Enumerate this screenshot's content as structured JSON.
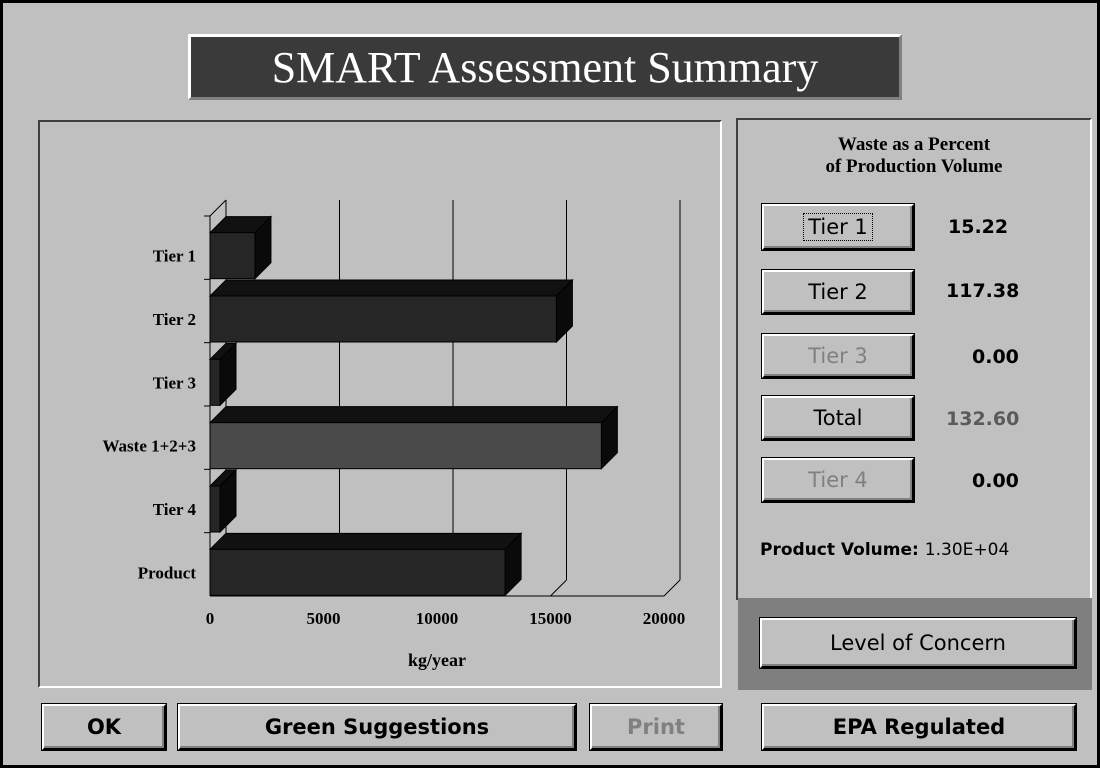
{
  "title": "SMART Assessment Summary",
  "chart_data": {
    "type": "bar",
    "orientation": "horizontal",
    "categories": [
      "Tier 1",
      "Tier 2",
      "Tier 3",
      "Waste 1+2+3",
      "Tier 4",
      "Product"
    ],
    "values": [
      1980,
      15260,
      0,
      17240,
      0,
      13000
    ],
    "xlabel": "kg/year",
    "xlim": [
      0,
      20000
    ],
    "xticks": [
      "0",
      "5000",
      "10000",
      "15000",
      "20000"
    ],
    "grid": true
  },
  "panel": {
    "heading_line1": "Waste as a Percent",
    "heading_line2": "of  Production Volume",
    "rows": [
      {
        "label": "Tier 1",
        "value": "15.22"
      },
      {
        "label": "Tier 2",
        "value": "117.38"
      },
      {
        "label": "Tier 3",
        "value": "0.00"
      },
      {
        "label": "Total",
        "value": "132.60"
      },
      {
        "label": "Tier 4",
        "value": "0.00"
      }
    ],
    "product_volume_label": "Product Volume:",
    "product_volume_value": "1.30E+04"
  },
  "buttons": {
    "ok": "OK",
    "green": "Green Suggestions",
    "print": "Print",
    "epa": "EPA Regulated",
    "concern": "Level of Concern"
  },
  "colors": {
    "background": "#c0c0c0",
    "title_bg": "#3a3a3a",
    "bar_dark": "#262626",
    "bar_total": "#4a4a4a"
  }
}
